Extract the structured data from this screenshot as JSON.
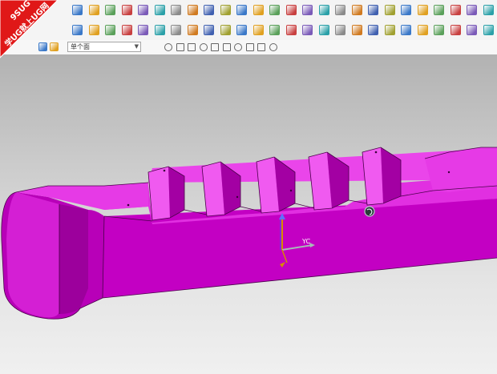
{
  "logo": {
    "text_line1": "9SUG",
    "text_line2": "学UG就上UG网"
  },
  "toolbar3": {
    "mode_select_value": "单个面"
  },
  "viewport": {
    "axis_label_yc": "YC"
  },
  "colors": {
    "part": "#cc00cc",
    "part_dark": "#8a008a",
    "part_light": "#ff4dff",
    "logo_red": "#e01818"
  },
  "icons": {
    "row1": [
      "move-icon",
      "sketch-icon",
      "block-icon",
      "cylinder-icon",
      "cone-icon",
      "point-icon",
      "extrude-icon",
      "revolve-icon",
      "sweep-icon",
      "blend-icon",
      "chamfer-icon",
      "shell-icon",
      "hole-icon",
      "boolean-icon",
      "trim-icon",
      "offset-icon",
      "pattern-icon",
      "draft-icon",
      "rect-icon",
      "plane-icon",
      "surface-icon",
      "mesh-icon",
      "curve-icon",
      "sew-icon",
      "thicken-icon",
      "wrap-icon"
    ],
    "row2": [
      "line-icon",
      "arc-icon",
      "spline-icon",
      "fillet-icon",
      "project-icon",
      "intersect-icon",
      "extract-icon",
      "bridge-icon",
      "helix-icon",
      "text-icon",
      "offset-curve-icon",
      "mirror-icon",
      "divide-icon",
      "join-icon",
      "analysis-icon",
      "measure-icon",
      "section-icon",
      "display-icon",
      "hide-icon",
      "layer-icon",
      "color-icon",
      "snap-icon",
      "selection-icon",
      "line-tool-icon",
      "curve-tool-icon",
      "zigzag-icon"
    ],
    "row3": [
      "filter-icon",
      "face-icon",
      "snap-endpoint-icon",
      "snap-midpoint-icon",
      "snap-control-icon",
      "snap-intersection-icon",
      "snap-center-icon",
      "snap-quadrant-icon",
      "snap-existing-icon",
      "snap-onpoint-icon",
      "snap-oncurve-icon",
      "snap-onface-icon"
    ]
  }
}
